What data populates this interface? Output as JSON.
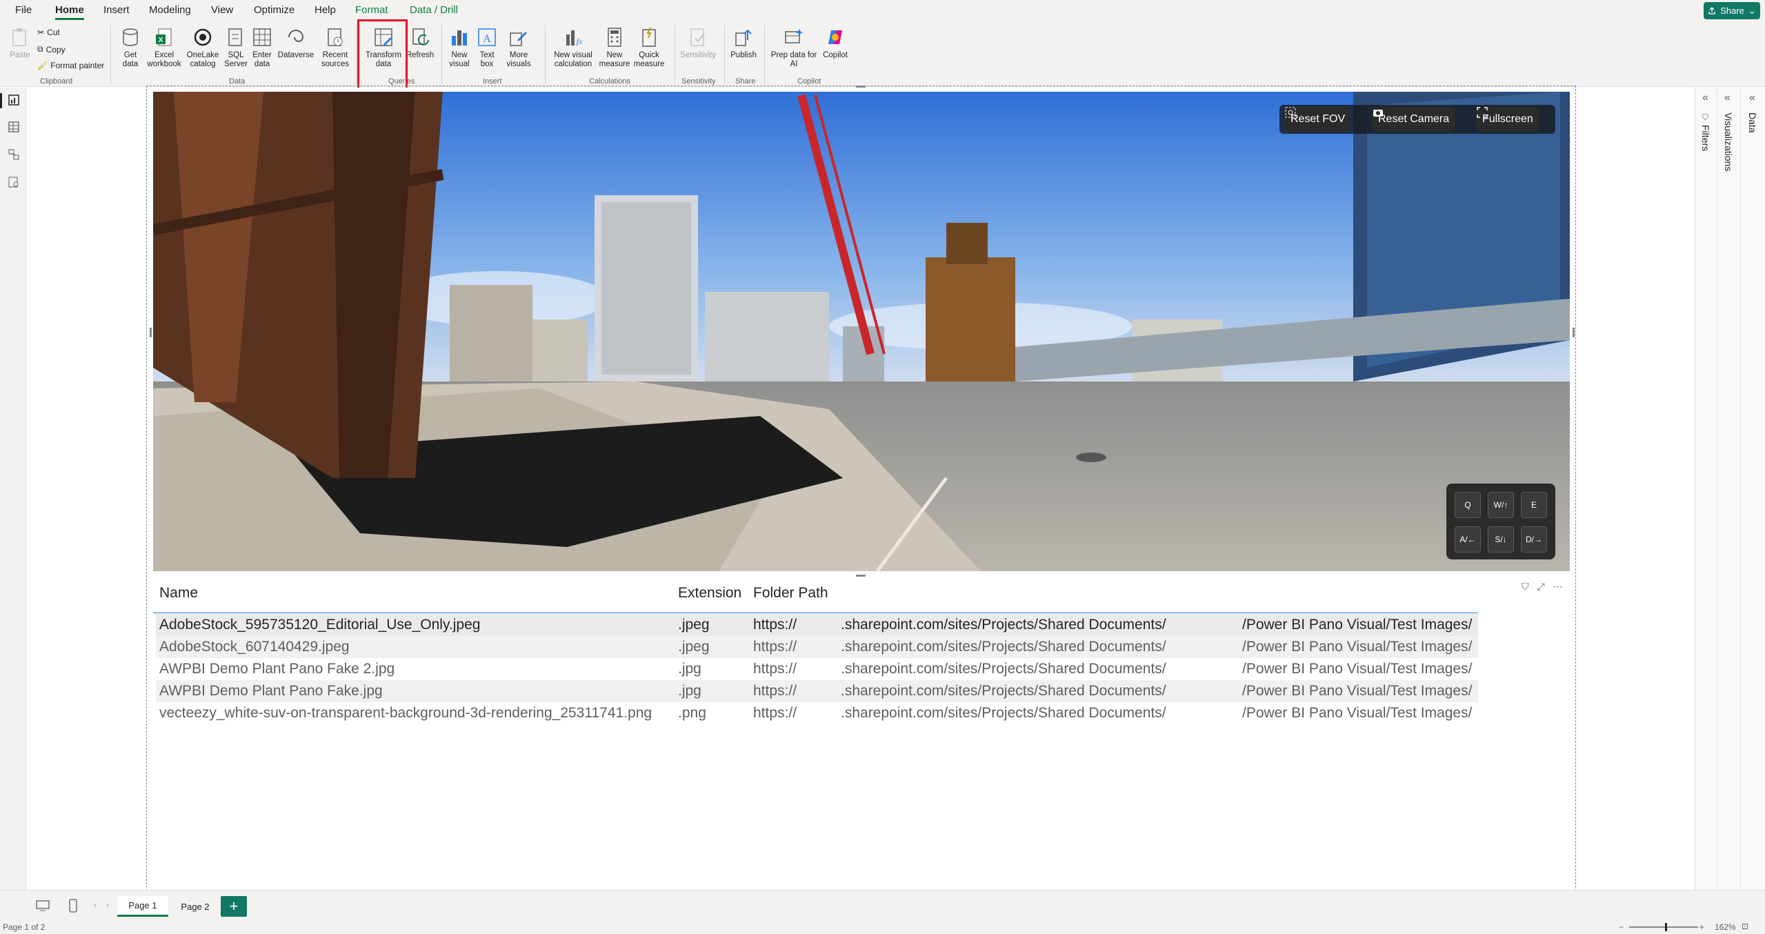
{
  "menu": {
    "tabs": [
      "File",
      "Home",
      "Insert",
      "Modeling",
      "View",
      "Optimize",
      "Help",
      "Format",
      "Data / Drill"
    ],
    "active": "Home",
    "share_label": "Share"
  },
  "ribbon": {
    "clipboard": {
      "paste": "Paste",
      "cut": "Cut",
      "copy": "Copy",
      "format_painter": "Format painter",
      "group": "Clipboard"
    },
    "data": {
      "get_data": "Get\ndata",
      "excel": "Excel\nworkbook",
      "onelake": "OneLake\ncatalog",
      "sql": "SQL\nServer",
      "enter": "Enter\ndata",
      "dataverse": "Dataverse",
      "recent": "Recent\nsources",
      "group": "Data"
    },
    "queries": {
      "transform": "Transform\ndata",
      "refresh": "Refresh",
      "group": "Queries"
    },
    "insert": {
      "new_visual": "New\nvisual",
      "text_box": "Text\nbox",
      "more_visuals": "More\nvisuals",
      "group": "Insert"
    },
    "calculations": {
      "new_visual_calc": "New visual\ncalculation",
      "new_measure": "New\nmeasure",
      "quick_measure": "Quick\nmeasure",
      "group": "Calculations"
    },
    "sensitivity": {
      "label": "Sensitivity",
      "group": "Sensitivity"
    },
    "share": {
      "publish": "Publish",
      "group": "Share"
    },
    "copilot": {
      "prep": "Prep data for\nAI",
      "copilot": "Copilot",
      "group": "Copilot"
    }
  },
  "pano": {
    "reset_fov": "Reset FOV",
    "reset_camera": "Reset Camera",
    "fullscreen": "Fullscreen",
    "keys": [
      "Q",
      "W/↑",
      "E",
      "A/←",
      "S/↓",
      "D/→"
    ]
  },
  "table": {
    "headers": [
      "Name",
      "Extension",
      "Folder Path"
    ],
    "rows": [
      {
        "name": "AdobeStock_595735120_Editorial_Use_Only.jpeg",
        "ext": ".jpeg",
        "p1": "https://",
        "p2": ".sharepoint.com/sites/Projects/Shared Documents/",
        "p3": "/Power BI Pano Visual/Test Images/"
      },
      {
        "name": "AdobeStock_607140429.jpeg",
        "ext": ".jpeg",
        "p1": "https://",
        "p2": ".sharepoint.com/sites/Projects/Shared Documents/",
        "p3": "/Power BI Pano Visual/Test Images/"
      },
      {
        "name": "AWPBI Demo Plant Pano Fake 2.jpg",
        "ext": ".jpg",
        "p1": "https://",
        "p2": ".sharepoint.com/sites/Projects/Shared Documents/",
        "p3": "/Power BI Pano Visual/Test Images/"
      },
      {
        "name": "AWPBI Demo Plant Pano Fake.jpg",
        "ext": ".jpg",
        "p1": "https://",
        "p2": ".sharepoint.com/sites/Projects/Shared Documents/",
        "p3": "/Power BI Pano Visual/Test Images/"
      },
      {
        "name": "vecteezy_white-suv-on-transparent-background-3d-rendering_25311741.png",
        "ext": ".png",
        "p1": "https://",
        "p2": ".sharepoint.com/sites/Projects/Shared Documents/",
        "p3": "/Power BI Pano Visual/Test Images/"
      }
    ]
  },
  "panes": {
    "filters": "Filters",
    "visualizations": "Visualizations",
    "data": "Data"
  },
  "pages": {
    "page1": "Page 1",
    "page2": "Page 2",
    "add": "+"
  },
  "status": {
    "page_info": "Page 1 of 2",
    "zoom": "162%"
  },
  "colors": {
    "brand_green": "#117865",
    "highlight_red": "#e81123",
    "table_accent": "#2b7de9"
  }
}
